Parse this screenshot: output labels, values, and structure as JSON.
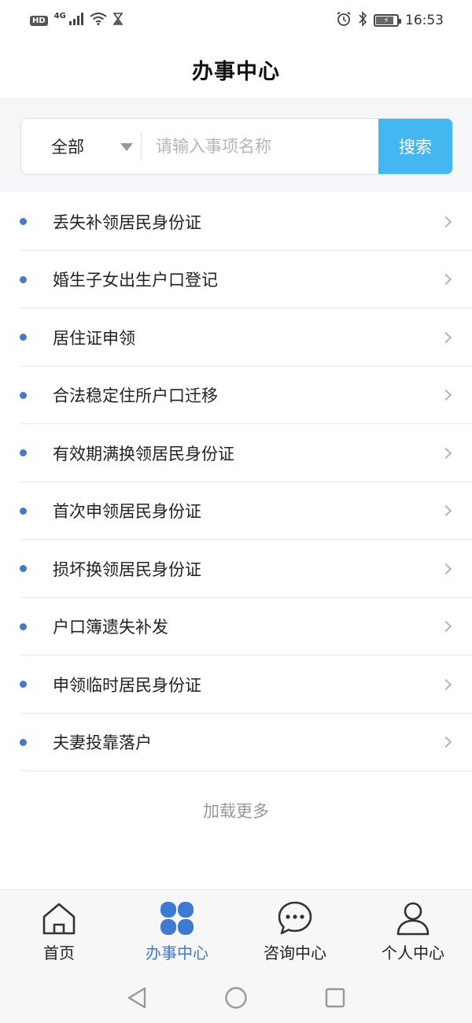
{
  "status_bar": {
    "hd": "HD",
    "network": "4G",
    "time": "16:53"
  },
  "header": {
    "title": "办事中心"
  },
  "search": {
    "category": "全部",
    "placeholder": "请输入事项名称",
    "button_label": "搜索"
  },
  "items": [
    {
      "label": "丢失补领居民身份证"
    },
    {
      "label": "婚生子女出生户口登记"
    },
    {
      "label": "居住证申领"
    },
    {
      "label": "合法稳定住所户口迁移"
    },
    {
      "label": "有效期满换领居民身份证"
    },
    {
      "label": "首次申领居民身份证"
    },
    {
      "label": "损坏换领居民身份证"
    },
    {
      "label": "户口簿遗失补发"
    },
    {
      "label": "申领临时居民身份证"
    },
    {
      "label": "夫妻投靠落户"
    }
  ],
  "load_more": "加载更多",
  "tabs": [
    {
      "label": "首页",
      "icon": "home-icon",
      "active": false
    },
    {
      "label": "办事中心",
      "icon": "clover-icon",
      "active": true
    },
    {
      "label": "咨询中心",
      "icon": "chat-icon",
      "active": false
    },
    {
      "label": "个人中心",
      "icon": "person-icon",
      "active": false
    }
  ],
  "colors": {
    "accent": "#3f7ad2",
    "search_button": "#44b7f0",
    "bullet": "#4678c8"
  }
}
